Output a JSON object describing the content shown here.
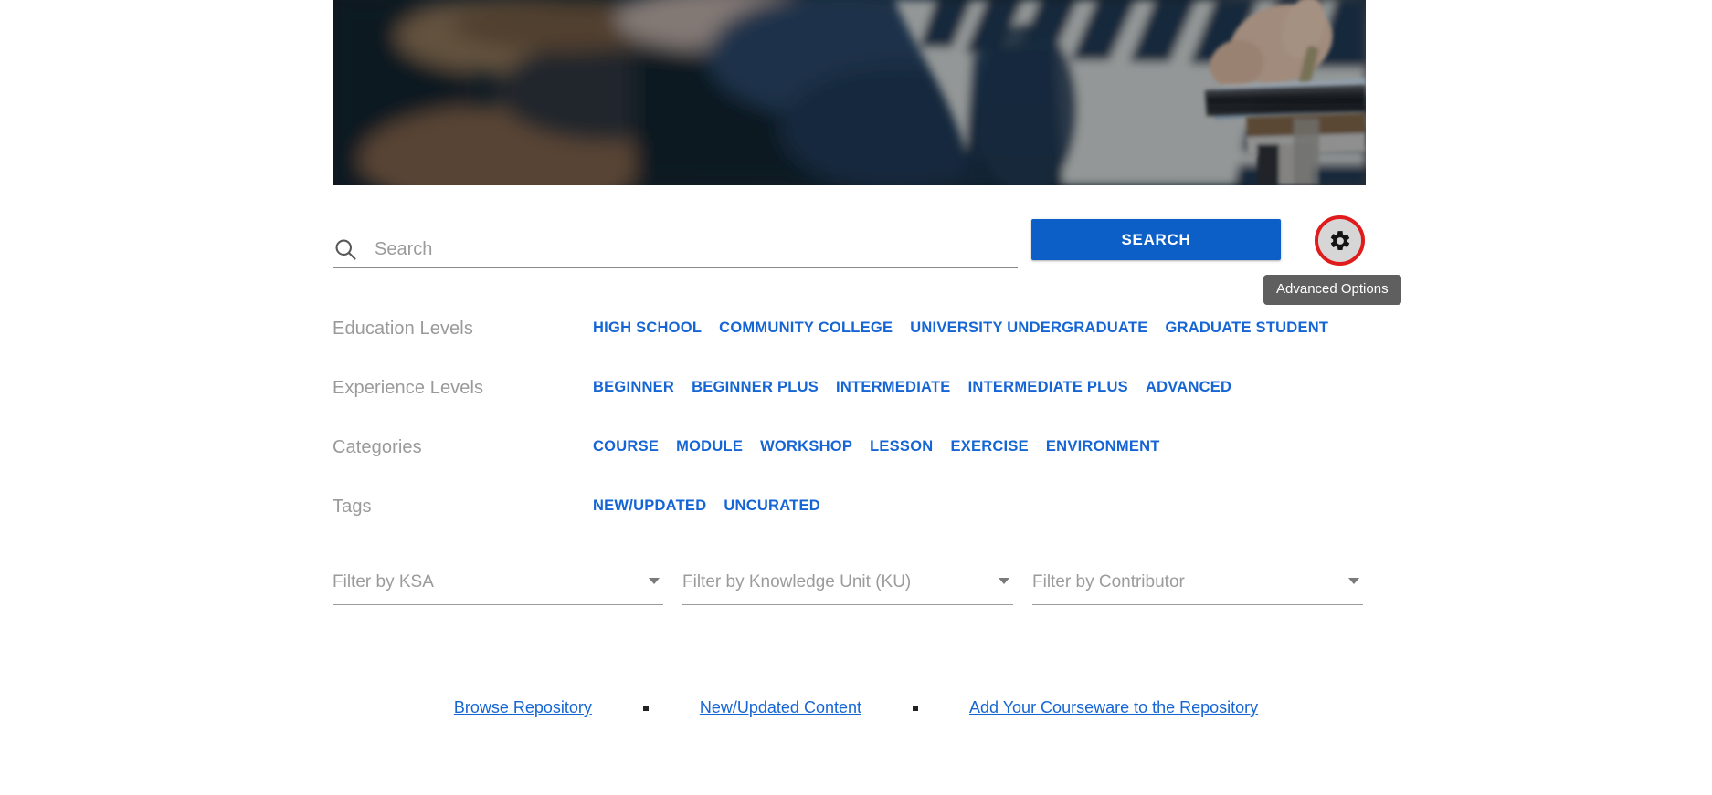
{
  "hero": {
    "alt": "blurred classroom photo of a student writing at a desk",
    "colors": {
      "dark_left": "#11202a",
      "wood": "#8a6a49",
      "navy": "#1d3350",
      "stripe_light": "#d8d9d3",
      "stripe_dark": "#1e3347"
    }
  },
  "search": {
    "placeholder": "Search",
    "value": "",
    "icon": "search-icon",
    "button_label": "SEARCH",
    "button_color": "#0c5fc6"
  },
  "advanced": {
    "icon": "gear-icon",
    "tooltip": "Advanced Options",
    "ring_color": "#e01b1b",
    "fill_color": "#d6d6d6",
    "tooltip_bg": "#5f5f5f"
  },
  "facets": [
    {
      "label": "Education Levels",
      "items": [
        "HIGH SCHOOL",
        "COMMUNITY COLLEGE",
        "UNIVERSITY UNDERGRADUATE",
        "GRADUATE STUDENT"
      ]
    },
    {
      "label": "Experience Levels",
      "items": [
        "BEGINNER",
        "BEGINNER PLUS",
        "INTERMEDIATE",
        "INTERMEDIATE PLUS",
        "ADVANCED"
      ]
    },
    {
      "label": "Categories",
      "items": [
        "COURSE",
        "MODULE",
        "WORKSHOP",
        "LESSON",
        "EXERCISE",
        "ENVIRONMENT"
      ]
    },
    {
      "label": "Tags",
      "items": [
        "NEW/UPDATED",
        "UNCURATED"
      ]
    }
  ],
  "dropdowns": [
    {
      "label": "Filter by KSA",
      "selected": "",
      "icon": "chevron-down-icon"
    },
    {
      "label": "Filter by Knowledge Unit (KU)",
      "selected": "",
      "icon": "chevron-down-icon"
    },
    {
      "label": "Filter by Contributor",
      "selected": "",
      "icon": "chevron-down-icon"
    }
  ],
  "footer": {
    "links": [
      "Browse Repository",
      "New/Updated Content",
      "Add Your Courseware to the Repository"
    ],
    "separator": "•",
    "link_color": "#1565d4"
  }
}
